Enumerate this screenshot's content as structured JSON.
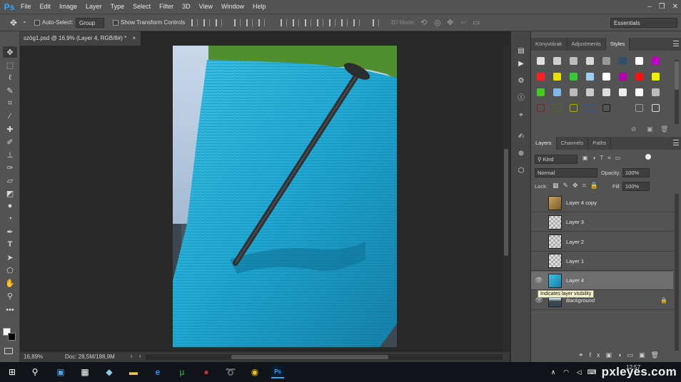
{
  "app": {
    "logo": "Ps"
  },
  "menu": [
    "File",
    "Edit",
    "Image",
    "Layer",
    "Type",
    "Select",
    "Filter",
    "3D",
    "View",
    "Window",
    "Help"
  ],
  "window_controls": [
    "–",
    "❐",
    "✕"
  ],
  "options": {
    "auto_select_label": "Auto-Select:",
    "auto_select_value": "Group",
    "show_transform_label": "Show Transform Controls",
    "mode_3d_label": "3D Mode:",
    "workspace": "Essentials"
  },
  "document": {
    "tab_title": "szög1.psd @ 16,9% (Layer 4, RGB/8#) *",
    "zoom": "16,89%",
    "doc_info": "Doc: 28,5M/188,9M"
  },
  "styles_panel": {
    "tabs": [
      "Könyvtárak",
      "Adjustments",
      "Styles"
    ],
    "active_tab": "Styles"
  },
  "layers_panel": {
    "tabs": [
      "Layers",
      "Channels",
      "Paths"
    ],
    "active_tab": "Layers",
    "filter_kind": "Kind",
    "blend_mode": "Normal",
    "opacity_label": "Opacity:",
    "opacity": "100%",
    "lock_label": "Lock:",
    "fill_label": "Fill:",
    "fill": "100%",
    "layers": [
      {
        "name": "Layer 4 copy",
        "visible": false,
        "selected": false,
        "thumb": "gold"
      },
      {
        "name": "Layer 3",
        "visible": false,
        "selected": false,
        "thumb": "checker"
      },
      {
        "name": "Layer 2",
        "visible": false,
        "selected": false,
        "thumb": "checker"
      },
      {
        "name": "Layer 1",
        "visible": false,
        "selected": false,
        "thumb": "checker"
      },
      {
        "name": "Layer 4",
        "visible": true,
        "selected": true,
        "thumb": "cyan"
      },
      {
        "name": "Background",
        "visible": true,
        "selected": false,
        "thumb": "city",
        "locked": true
      }
    ],
    "tooltip": "Indicates layer visibility"
  },
  "taskbar": {
    "clock": "12:57",
    "watermark": "pxleyes.com"
  },
  "colors": {
    "accent": "#31a8ff",
    "panel": "#535353",
    "towel": "#1fa9d4"
  }
}
